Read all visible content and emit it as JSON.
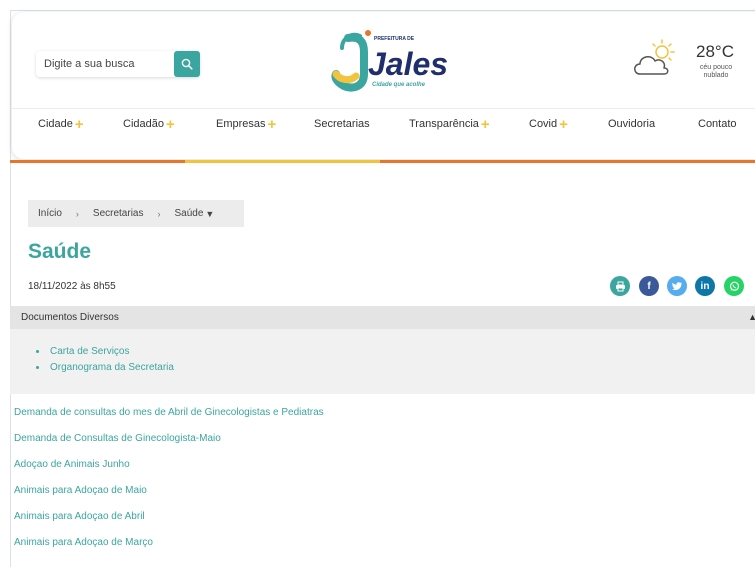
{
  "search": {
    "placeholder": "Digite a sua busca"
  },
  "logo": {
    "top_text": "PREFEITURA DE",
    "name": "Jales",
    "tagline": "Cidade que acolhe"
  },
  "weather": {
    "temperature": "28°C",
    "description": "céu pouco nublado",
    "icon": "partly-cloudy-icon"
  },
  "nav": {
    "items": [
      {
        "label": "Cidade",
        "plus": "+"
      },
      {
        "label": "Cidadão",
        "plus": "+"
      },
      {
        "label": "Empresas",
        "plus": "+"
      },
      {
        "label": "Secretarias",
        "plus": ""
      },
      {
        "label": "Transparência",
        "plus": "+"
      },
      {
        "label": "Covid",
        "plus": "+"
      },
      {
        "label": "Ouvidoria",
        "plus": ""
      },
      {
        "label": "Contato",
        "plus": ""
      }
    ]
  },
  "colors": {
    "accent": "#3ba5a0",
    "plus": "#f2c43d",
    "bar_orange": "#e7762b",
    "bar_yellow": "#f2c43d",
    "bar_teal": "#3ba5a0"
  },
  "breadcrumb": {
    "items": [
      "Início",
      "Secretarias",
      "Saúde"
    ],
    "separator": "›",
    "caret": "▼"
  },
  "page": {
    "title": "Saúde",
    "date": "18/11/2022 às 8h55"
  },
  "share": {
    "print": {
      "icon": "print-icon",
      "color": "#3ba5a0"
    },
    "facebook": {
      "icon": "facebook-icon",
      "label": "f",
      "color": "#3b5998"
    },
    "twitter": {
      "icon": "twitter-icon",
      "color": "#55acee"
    },
    "linkedin": {
      "icon": "linkedin-icon",
      "label": "in",
      "color": "#0e76a8"
    },
    "whatsapp": {
      "icon": "whatsapp-icon",
      "color": "#25d366"
    }
  },
  "documents": {
    "header": "Documentos Diversos",
    "items": [
      "Carta de Serviços",
      "Organograma da Secretaria"
    ]
  },
  "links": [
    "Demanda de consultas do mes de Abril de Ginecologistas e Pediatras",
    "Demanda de Consultas de Ginecologista-Maio",
    "Adoçao de Animais Junho",
    "Animais para Adoçao de Maio",
    "Animais para Adoçao de Abril",
    "Animais para Adoçao de Março"
  ]
}
